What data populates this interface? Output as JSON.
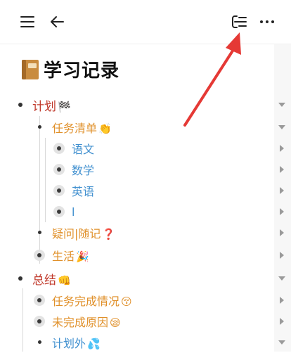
{
  "page": {
    "title": "学习记录",
    "title_icon": "notebook-icon"
  },
  "toolbar": {
    "menu_icon": "hamburger-icon",
    "back_icon": "back-arrow-icon",
    "outline_icon": "outline-indent-icon",
    "more_icon": "more-icon"
  },
  "colors": {
    "level1": "#c0392b",
    "level2": "#e0902a",
    "level3": "#3f8fcf",
    "annotation": "#e53935"
  },
  "outline": {
    "plan": {
      "label": "计划",
      "emoji": "🏁"
    },
    "task_list": {
      "label": "任务清单",
      "emoji": "👏"
    },
    "chinese": {
      "label": "语文"
    },
    "math": {
      "label": "数学"
    },
    "english": {
      "label": "英语"
    },
    "blank": {
      "label": "l"
    },
    "questions": {
      "label": "疑问|随记",
      "emoji": "❓"
    },
    "life": {
      "label": "生活",
      "emoji": "🎉"
    },
    "summary": {
      "label": "总结",
      "emoji": "👊"
    },
    "completion": {
      "label": "任务完成情况",
      "emoji": "😚"
    },
    "reasons": {
      "label": "未完成原因",
      "emoji": "😪"
    },
    "extra": {
      "label": "计划外",
      "emoji": "💦"
    }
  }
}
